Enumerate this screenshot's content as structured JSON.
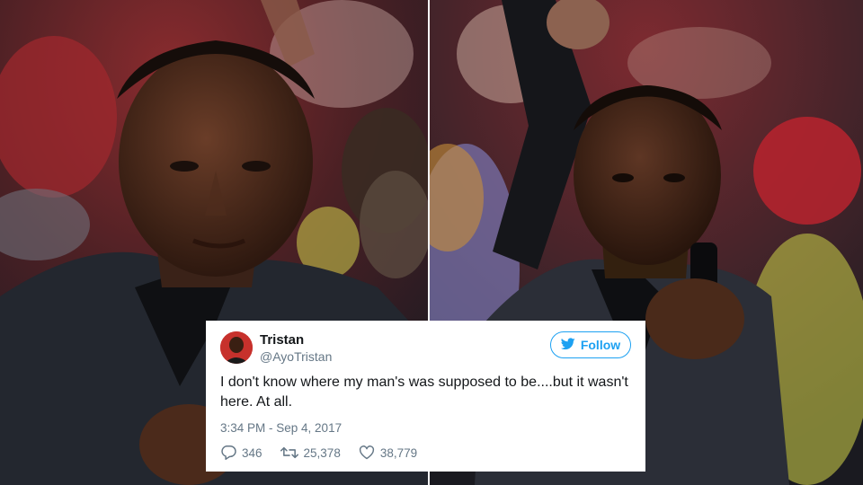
{
  "tweet": {
    "author_name": "Tristan",
    "author_handle": "@AyoTristan",
    "follow_label": "Follow",
    "text": "I don't know where my man's was supposed to be....but it wasn't here. At all.",
    "timestamp": "3:34 PM - Sep 4, 2017",
    "replies": "346",
    "retweets": "25,378",
    "likes": "38,779"
  },
  "icons": {
    "follow": "bird-icon",
    "reply": "speech-bubble-icon",
    "retweet": "retweet-icon",
    "like": "heart-icon"
  },
  "colors": {
    "accent": "#1da1f2",
    "meta_text": "#657786",
    "primary_text": "#14171a",
    "avatar_bg": "#c7312c"
  }
}
